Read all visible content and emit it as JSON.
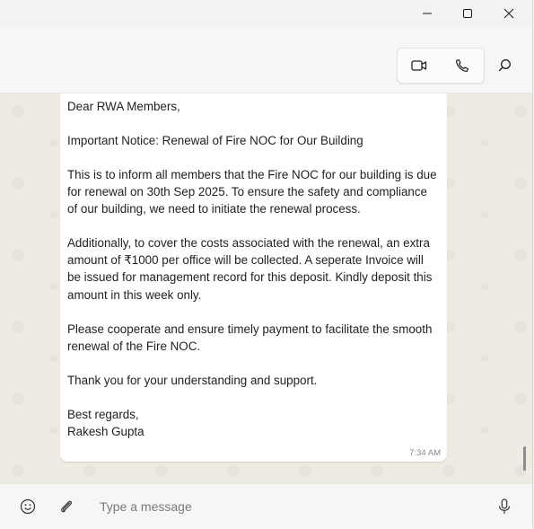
{
  "window": {
    "controls": [
      "minimize",
      "maximize",
      "close"
    ]
  },
  "header": {
    "icons": [
      "video-call-icon",
      "voice-call-icon",
      "search-icon"
    ]
  },
  "message": {
    "text": "Dear RWA Members,\n\nImportant Notice: Renewal of Fire NOC for Our Building\n\nThis is to inform all members that the Fire NOC for our building is due for renewal on 30th Sep 2025. To ensure the safety and compliance of our building, we need to initiate the renewal process.\n\nAdditionally, to cover the costs associated with the renewal, an extra amount of ₹1000 per office will be collected. A seperate Invoice will be issued for management record for this deposit. Kindly deposit this amount in this week only.\n\nPlease cooperate and ensure timely payment to facilitate the smooth renewal of the Fire NOC.\n\nThank you for your understanding and support.\n\nBest regards,\nRakesh Gupta",
    "time": "7:34 AM"
  },
  "composer": {
    "placeholder": "Type a message",
    "value": ""
  },
  "colors": {
    "chat_background": "#efeae2",
    "bubble": "#ffffff",
    "chrome": "#f6f6f6"
  }
}
